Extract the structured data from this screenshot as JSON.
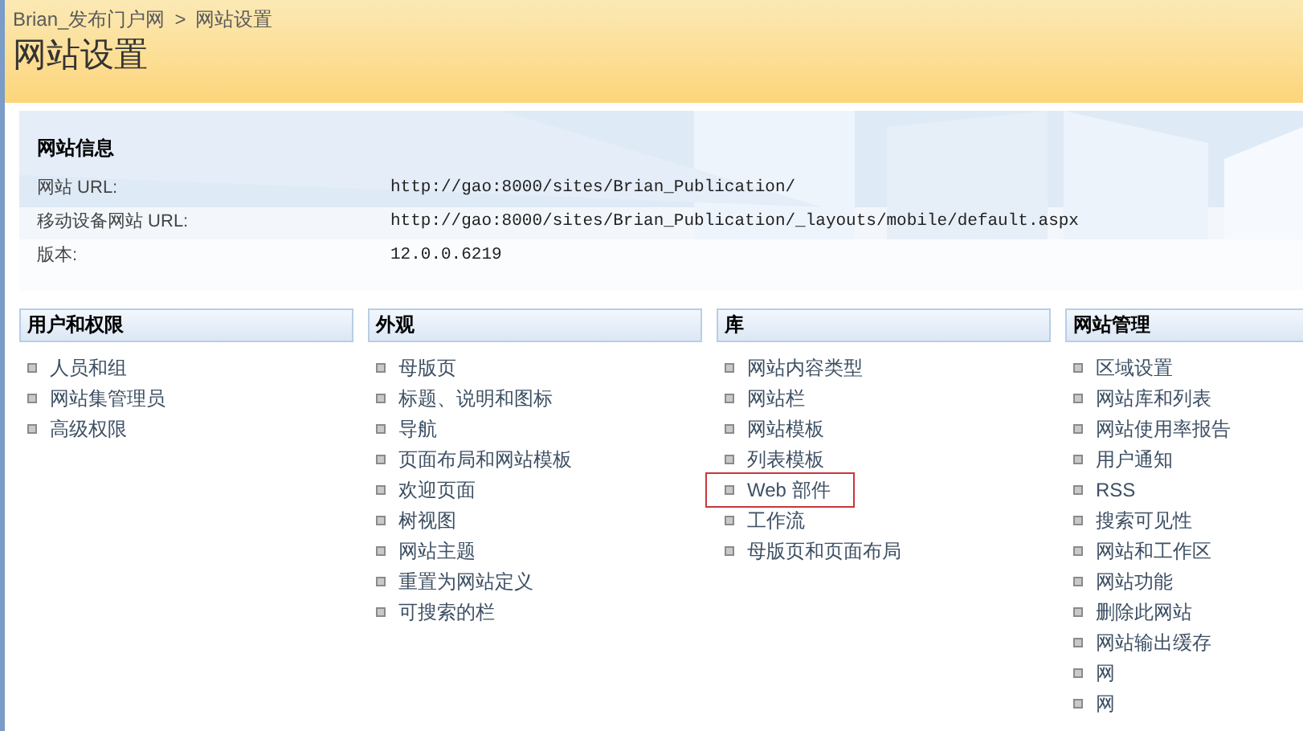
{
  "breadcrumb": [
    "Brian_发布门户网",
    "网站设置"
  ],
  "breadcrumb_separator": ">",
  "title": "网站设置",
  "site_info": {
    "heading": "网站信息",
    "rows": [
      {
        "label": "网站 URL:",
        "value": "http://gao:8000/sites/Brian_Publication/"
      },
      {
        "label": "移动设备网站 URL:",
        "value": "http://gao:8000/sites/Brian_Publication/_layouts/mobile/default.aspx"
      },
      {
        "label": "版本:",
        "value": "12.0.0.6219"
      }
    ]
  },
  "sections": [
    {
      "heading": "用户和权限",
      "items": [
        {
          "label": "人员和组",
          "highlighted": false
        },
        {
          "label": "网站集管理员",
          "highlighted": false
        },
        {
          "label": "高级权限",
          "highlighted": false
        }
      ]
    },
    {
      "heading": "外观",
      "items": [
        {
          "label": "母版页",
          "highlighted": false
        },
        {
          "label": "标题、说明和图标",
          "highlighted": false
        },
        {
          "label": "导航",
          "highlighted": false
        },
        {
          "label": "页面布局和网站模板",
          "highlighted": false
        },
        {
          "label": "欢迎页面",
          "highlighted": false
        },
        {
          "label": "树视图",
          "highlighted": false
        },
        {
          "label": "网站主题",
          "highlighted": false
        },
        {
          "label": "重置为网站定义",
          "highlighted": false
        },
        {
          "label": "可搜索的栏",
          "highlighted": false
        }
      ]
    },
    {
      "heading": "库",
      "items": [
        {
          "label": "网站内容类型",
          "highlighted": false
        },
        {
          "label": "网站栏",
          "highlighted": false
        },
        {
          "label": "网站模板",
          "highlighted": false
        },
        {
          "label": "列表模板",
          "highlighted": false
        },
        {
          "label": "Web 部件",
          "highlighted": true
        },
        {
          "label": "工作流",
          "highlighted": false
        },
        {
          "label": "母版页和页面布局",
          "highlighted": false
        }
      ]
    },
    {
      "heading": "网站管理",
      "items": [
        {
          "label": "区域设置",
          "highlighted": false
        },
        {
          "label": "网站库和列表",
          "highlighted": false
        },
        {
          "label": "网站使用率报告",
          "highlighted": false
        },
        {
          "label": "用户通知",
          "highlighted": false
        },
        {
          "label": "RSS",
          "highlighted": false
        },
        {
          "label": "搜索可见性",
          "highlighted": false
        },
        {
          "label": "网站和工作区",
          "highlighted": false
        },
        {
          "label": "网站功能",
          "highlighted": false
        },
        {
          "label": "删除此网站",
          "highlighted": false
        },
        {
          "label": "网站输出缓存",
          "highlighted": false
        },
        {
          "label": "网",
          "highlighted": false
        },
        {
          "label": "网",
          "highlighted": false
        }
      ]
    }
  ]
}
